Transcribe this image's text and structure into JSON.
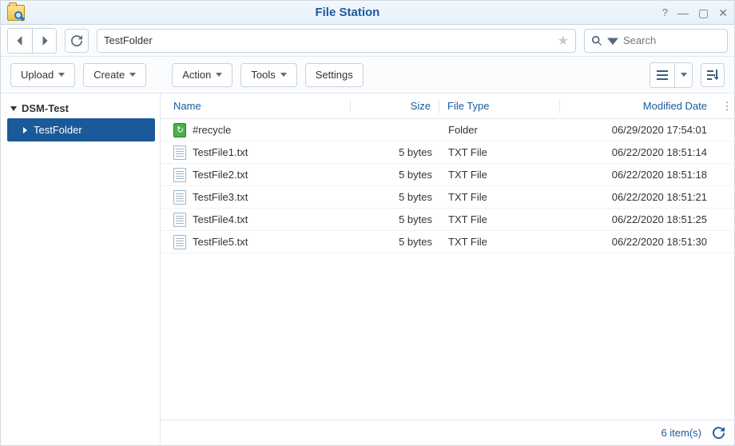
{
  "window": {
    "title": "File Station"
  },
  "nav": {
    "path": "TestFolder",
    "search_placeholder": "Search"
  },
  "toolbar": {
    "upload": "Upload",
    "create": "Create",
    "action": "Action",
    "tools": "Tools",
    "settings": "Settings"
  },
  "sidebar": {
    "root": "DSM-Test",
    "child": "TestFolder"
  },
  "columns": {
    "name": "Name",
    "size": "Size",
    "type": "File Type",
    "date": "Modified Date"
  },
  "rows": [
    {
      "icon": "recycle",
      "name": "#recycle",
      "size": "",
      "type": "Folder",
      "date": "06/29/2020 17:54:01"
    },
    {
      "icon": "file",
      "name": "TestFile1.txt",
      "size": "5 bytes",
      "type": "TXT File",
      "date": "06/22/2020 18:51:14"
    },
    {
      "icon": "file",
      "name": "TestFile2.txt",
      "size": "5 bytes",
      "type": "TXT File",
      "date": "06/22/2020 18:51:18"
    },
    {
      "icon": "file",
      "name": "TestFile3.txt",
      "size": "5 bytes",
      "type": "TXT File",
      "date": "06/22/2020 18:51:21"
    },
    {
      "icon": "file",
      "name": "TestFile4.txt",
      "size": "5 bytes",
      "type": "TXT File",
      "date": "06/22/2020 18:51:25"
    },
    {
      "icon": "file",
      "name": "TestFile5.txt",
      "size": "5 bytes",
      "type": "TXT File",
      "date": "06/22/2020 18:51:30"
    }
  ],
  "status": {
    "count": "6 item(s)"
  }
}
